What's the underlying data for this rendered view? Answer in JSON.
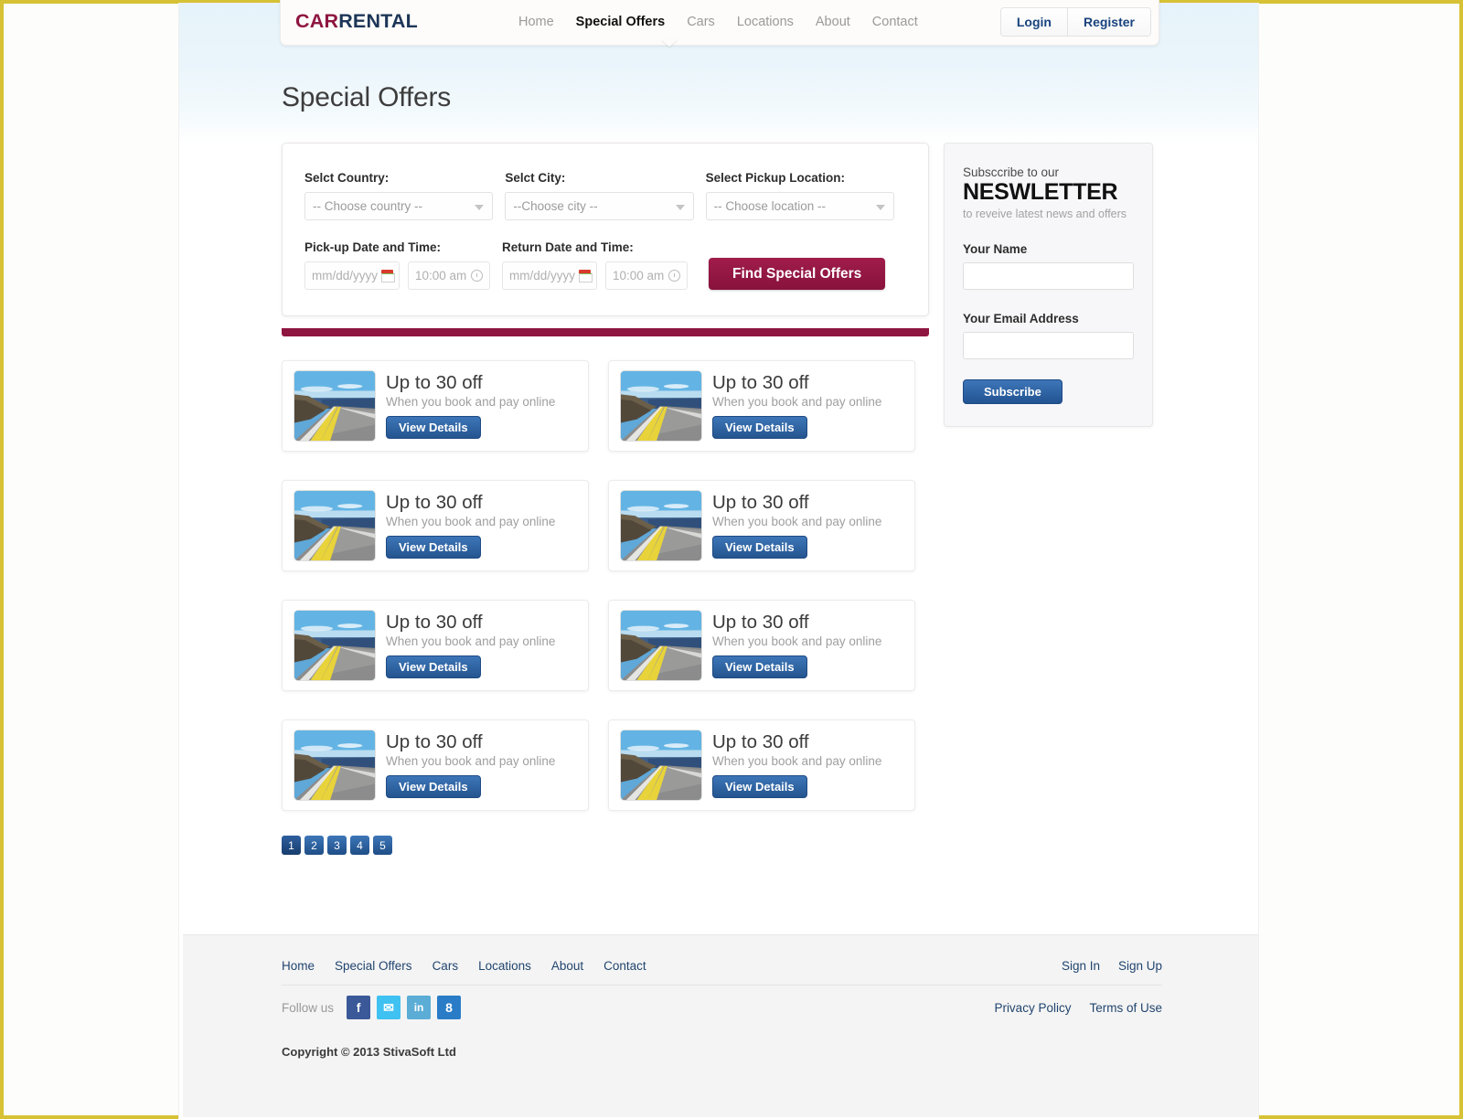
{
  "header": {
    "logo_car": "CAR",
    "logo_rental": "RENTAL",
    "nav": [
      {
        "label": "Home",
        "active": false
      },
      {
        "label": "Special Offers",
        "active": true
      },
      {
        "label": "Cars",
        "active": false
      },
      {
        "label": "Locations",
        "active": false
      },
      {
        "label": "About",
        "active": false
      },
      {
        "label": "Contact",
        "active": false
      }
    ],
    "login_label": "Login",
    "register_label": "Register"
  },
  "page_title": "Special Offers",
  "search_form": {
    "country_label": "Selct Country:",
    "country_value": "-- Choose country --",
    "city_label": "Selct City:",
    "city_value": "--Choose city --",
    "location_label": "Select Pickup Location:",
    "location_value": "-- Choose location --",
    "pickup_label": "Pick-up Date and Time:",
    "return_label": "Return Date and Time:",
    "pickup_date_placeholder": "mm/dd/yyyy",
    "pickup_time_placeholder": "10:00 am",
    "return_date_placeholder": "mm/dd/yyyy",
    "return_time_placeholder": "10:00 am",
    "submit_label": "Find Special Offers",
    "accent_color": "#8e1540"
  },
  "newsletter": {
    "subscribe_line": "Subsccribe to our",
    "title": "NESWLETTER",
    "tagline": "to reveive latest news and offers",
    "name_label": "Your Name",
    "name_value": "",
    "email_label": "Your Email Address",
    "email_value": "",
    "button_label": "Subscribe",
    "button_color": "#2a5a99"
  },
  "offers": [
    {
      "title": "Up to 30 off",
      "subtitle": "When you book and pay online",
      "button": "View Details"
    },
    {
      "title": "Up to 30 off",
      "subtitle": "When you book and pay online",
      "button": "View Details"
    },
    {
      "title": "Up to 30 off",
      "subtitle": "When you book and pay online",
      "button": "View Details"
    },
    {
      "title": "Up to 30 off",
      "subtitle": "When you book and pay online",
      "button": "View Details"
    },
    {
      "title": "Up to 30 off",
      "subtitle": "When you book and pay online",
      "button": "View Details"
    },
    {
      "title": "Up to 30 off",
      "subtitle": "When you book and pay online",
      "button": "View Details"
    },
    {
      "title": "Up to 30 off",
      "subtitle": "When you book and pay online",
      "button": "View Details"
    },
    {
      "title": "Up to 30 off",
      "subtitle": "When you book and pay online",
      "button": "View Details"
    }
  ],
  "pagination": {
    "pages": [
      "1",
      "2",
      "3",
      "4",
      "5"
    ],
    "current": "1"
  },
  "footer": {
    "links": [
      "Home",
      "Special Offers",
      "Cars",
      "Locations",
      "About",
      "Contact"
    ],
    "sign_in": "Sign In",
    "sign_up": "Sign Up",
    "follow_label": "Follow us",
    "social": [
      {
        "name": "facebook",
        "glyph": "f",
        "color": "#3b5998"
      },
      {
        "name": "twitter",
        "glyph": "✉",
        "color": "#3fc1f2"
      },
      {
        "name": "linkedin",
        "glyph": "in",
        "color": "#5badd6"
      },
      {
        "name": "googleplus",
        "glyph": "8",
        "color": "#2a7cc7"
      }
    ],
    "privacy_policy": "Privacy Policy",
    "terms_of_use": "Terms of Use",
    "copyright": "Copyright © 2013 StivaSoft Ltd"
  }
}
